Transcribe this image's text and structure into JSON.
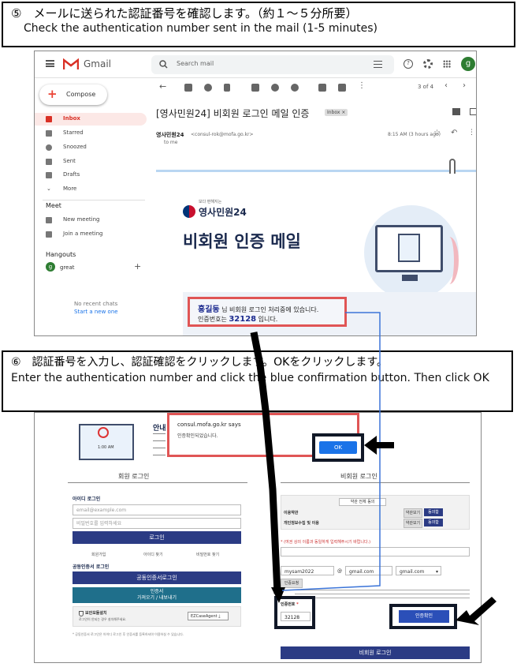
{
  "step5": {
    "jp": "⑤　メールに送られた認証番号を確認します。（約１～５分所要）",
    "en": "Check the authentication number sent in the mail (1-5 minutes)"
  },
  "step6": {
    "jp": "⑥　認証番号を入力し、認証確認をクリックします。OKをクリックします。",
    "en": "Enter the authentication number and click the blue confirmation button. Then click OK"
  },
  "gmail": {
    "app_name": "Gmail",
    "search_placeholder": "Search mail",
    "avatar_letter": "g",
    "compose": "Compose",
    "nav": [
      "Inbox",
      "Starred",
      "Snoozed",
      "Sent",
      "Drafts",
      "More"
    ],
    "meet_title": "Meet",
    "meet_items": [
      "New meeting",
      "Join a meeting"
    ],
    "hangouts_title": "Hangouts",
    "hangouts_user": "great",
    "no_chats": "No recent chats",
    "start_new": "Start a new one",
    "pager": "3 of 4",
    "subject": "[영사민원24] 비회원 로그인 메일 인증",
    "inbox_badge": "Inbox ×",
    "sender_name": "영사민원24",
    "sender_email": "<consul-rok@mofa.go.kr>",
    "time": "8:15 AM (3 hours ago)",
    "to": "to me",
    "logo_small": "보다 편해지는",
    "logo": "영사민원24",
    "banner_title": "비회원 인증 메일",
    "name": "홍길동",
    "line1": " 님 비회원 로그인 처리중에 있습니다.",
    "line2_prefix": "인증번호는 ",
    "code": "32128",
    "line2_suffix": " 입니다."
  },
  "portal": {
    "guide_title": "안내",
    "member_login": "회원 로그인",
    "nonmember_login": "비회원 로그인",
    "id_login": "아이디 로그인",
    "email_placeholder": "email@example.com",
    "password_placeholder": "비밀번호를 입력하세요",
    "login_btn": "로그인",
    "links": [
      "회원가입",
      "아이디 찾기",
      "비밀번호 찾기"
    ],
    "cert_title": "공동인증서 로그인",
    "cert_btn": "공동인증서로그인",
    "cert_btn2_l1": "인증서",
    "cert_btn2_l2": "가져오기 / 내보내기",
    "security_title": "보안모듈설치",
    "security_desc": "로그인이 안되는 경우 설치해주세요.",
    "ezcase": "EZCaseAgent",
    "cert_note": "* 공동인증서 로그인은 아이디 로그인 후 인증서를 등록하셔야 이용하실 수 있습니다.",
    "terms_all": "약관 전체 동의",
    "term1": "이용약관",
    "term2": "개인정보수집 및 이용",
    "view_btn": "약관보기",
    "agree_btn": "동의함",
    "name_note": "* (여권 상의 이름과 동일하게 입력해주시기 바랍니다.)",
    "email_id": "mysam2022",
    "at": "@",
    "domain": "gmail.com",
    "domain_select": "gmail.com",
    "send_btn": "인증요청",
    "auth_label": "인증번호",
    "auth_required": "*",
    "auth_value": "32128",
    "confirm_btn": "인증확인",
    "nonmember_btn": "비회원 로그인",
    "dialog_title": "consul.mofa.go.kr says",
    "dialog_msg": "인증확인되었습니다.",
    "ok": "OK",
    "monitor_time": "1:00 AM"
  },
  "colors": {
    "gmail_red": "#d93025",
    "navy": "#2b3b84",
    "blue": "#1a73e8",
    "highlight_red": "#e05555",
    "highlight_navy": "#111827"
  },
  "icons": [
    "hamburger-icon",
    "gmail-logo-icon",
    "search-icon",
    "filter-icon",
    "help-icon",
    "settings-icon",
    "apps-icon",
    "back-icon",
    "archive-icon",
    "report-icon",
    "delete-icon",
    "mail-icon",
    "clock-icon",
    "task-icon",
    "move-icon",
    "label-icon",
    "more-icon",
    "prev-icon",
    "next-icon",
    "print-icon",
    "open-icon",
    "star-icon",
    "reply-icon",
    "attachment-icon",
    "arrow-icon"
  ]
}
